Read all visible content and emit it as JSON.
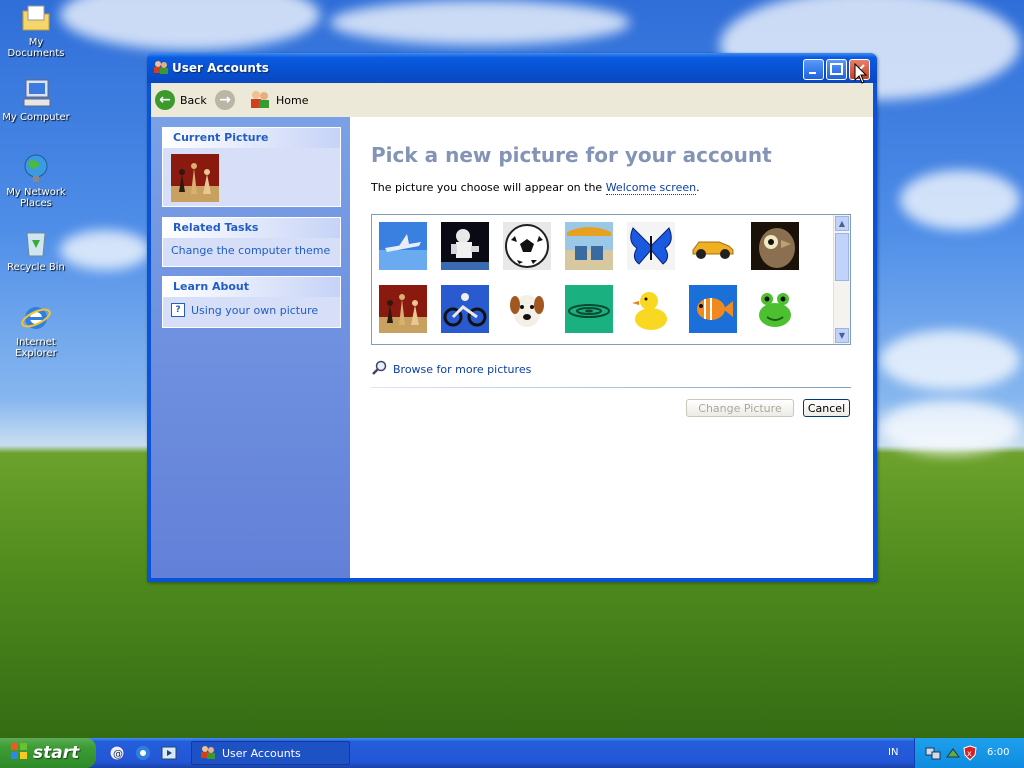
{
  "desktop": {
    "icons": [
      {
        "label": "My Documents"
      },
      {
        "label": "My Computer"
      },
      {
        "label": "My Network Places"
      },
      {
        "label": "Recycle Bin"
      },
      {
        "label": "Internet Explorer"
      }
    ]
  },
  "window": {
    "title": "User Accounts",
    "toolbar": {
      "back": "Back",
      "home": "Home"
    },
    "sidebar": {
      "current_picture": {
        "header": "Current Picture"
      },
      "related_tasks": {
        "header": "Related Tasks",
        "items": [
          "Change the computer theme"
        ]
      },
      "learn_about": {
        "header": "Learn About",
        "items": [
          "Using your own picture"
        ]
      }
    },
    "main": {
      "heading": "Pick a new picture for your account",
      "description_prefix": "The picture you choose will appear on the ",
      "description_link": "Welcome screen",
      "description_suffix": ".",
      "browse_link": "Browse for more pictures",
      "change_button": "Change Picture",
      "cancel_button": "Cancel"
    },
    "pictures": [
      "airplane",
      "astronaut",
      "soccer ball",
      "beach chairs",
      "butterfly",
      "car",
      "owl",
      "chess",
      "dirt bike",
      "dog",
      "drip",
      "duck",
      "fish",
      "frog"
    ]
  },
  "taskbar": {
    "start_label": "start",
    "task_label": "User Accounts",
    "language": "IN",
    "clock": "6:00"
  },
  "colors": {
    "titlebar": "#0a5be0",
    "sidebar": "#6f8fe0",
    "heading": "#8494b6",
    "link": "#0a3fa8"
  }
}
